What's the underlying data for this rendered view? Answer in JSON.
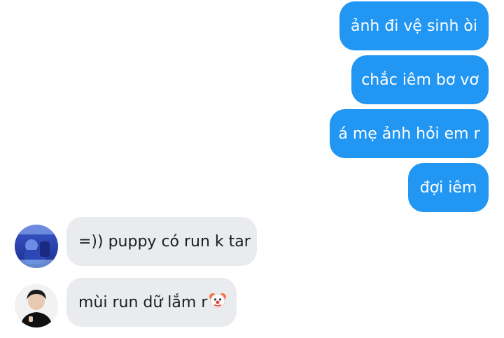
{
  "conversation": {
    "sent": [
      {
        "text": "ảnh đi vệ sinh òi"
      },
      {
        "text": "chắc iêm bơ vơ"
      },
      {
        "text": "á mẹ ảnh hỏi em r"
      },
      {
        "text": "đợi iêm"
      }
    ],
    "received": [
      {
        "text": "=)) puppy có run k tar",
        "avatar": "contact-avatar-blue-photo"
      },
      {
        "text": "mùi run dữ lắm r",
        "emoji": "clown-face-icon",
        "avatar": "contact-avatar-person-photo"
      }
    ]
  },
  "colors": {
    "sent_bubble": "#2196f3",
    "received_bubble": "#e9ebee",
    "sent_text": "#ffffff",
    "received_text": "#1c1e21"
  }
}
